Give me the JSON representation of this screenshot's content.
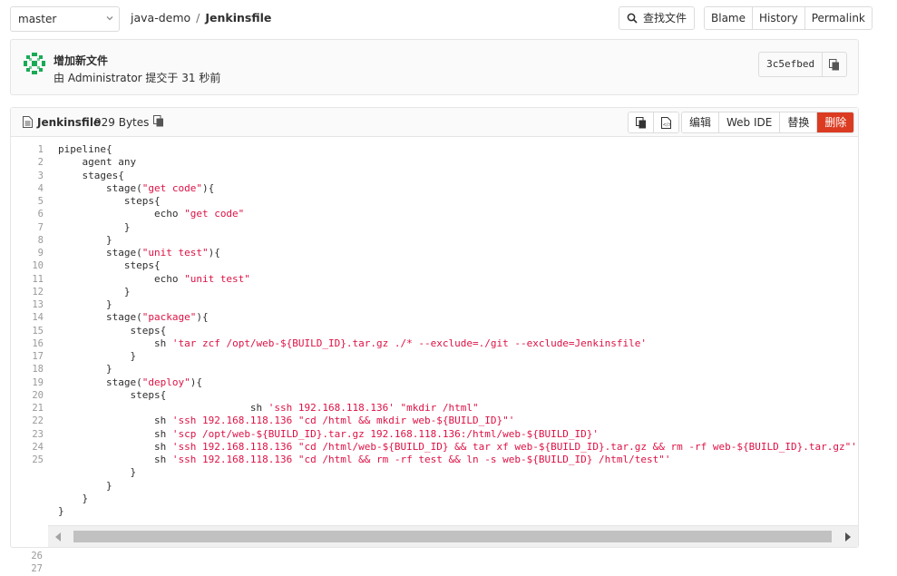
{
  "header": {
    "branch": "master",
    "breadcrumb": {
      "project": "java-demo",
      "separator": "/",
      "file": "Jenkinsfile"
    },
    "find_file_label": "查找文件",
    "view_buttons": [
      "Blame",
      "History",
      "Permalink"
    ]
  },
  "commit": {
    "title": "增加新文件",
    "meta": "由 Administrator 提交于 31 秒前",
    "sha": "3c5efbed",
    "avatar_color": "#1aaa55"
  },
  "file": {
    "name": "Jenkinsfile",
    "size": "929 Bytes",
    "actions": {
      "edit": "编辑",
      "web_ide": "Web IDE",
      "replace": "替换",
      "delete": "删除"
    },
    "delete_color": "#db3b21"
  },
  "code": {
    "line_numbers": [
      "1",
      "2",
      "3",
      "4",
      "5",
      "6",
      "7",
      "8",
      "9",
      "10",
      "11",
      "12",
      "13",
      "14",
      "15",
      "16",
      "17",
      "18",
      "19",
      "20",
      "21",
      "22",
      "23",
      "24",
      "25"
    ],
    "extra_line_numbers": [
      "26",
      "27"
    ],
    "lines": [
      [
        {
          "t": "pipeline{"
        }
      ],
      [
        {
          "t": "    agent any"
        }
      ],
      [
        {
          "t": "    stages{"
        }
      ],
      [
        {
          "t": "        stage("
        },
        {
          "t": "\"get code\"",
          "s": 1
        },
        {
          "t": "){"
        }
      ],
      [
        {
          "t": "           steps{"
        }
      ],
      [
        {
          "t": "                echo "
        },
        {
          "t": "\"get code\"",
          "s": 1
        }
      ],
      [
        {
          "t": "           }"
        }
      ],
      [
        {
          "t": "        }"
        }
      ],
      [
        {
          "t": "        stage("
        },
        {
          "t": "\"unit test\"",
          "s": 1
        },
        {
          "t": "){"
        }
      ],
      [
        {
          "t": "           steps{"
        }
      ],
      [
        {
          "t": "                echo "
        },
        {
          "t": "\"unit test\"",
          "s": 1
        }
      ],
      [
        {
          "t": "           }"
        }
      ],
      [
        {
          "t": "        }"
        }
      ],
      [
        {
          "t": "        stage("
        },
        {
          "t": "\"package\"",
          "s": 1
        },
        {
          "t": "){"
        }
      ],
      [
        {
          "t": "            steps{"
        }
      ],
      [
        {
          "t": "                sh "
        },
        {
          "t": "'tar zcf /opt/web-${BUILD_ID}.tar.gz ./* --exclude=./git --exclude=Jenkinsfile'",
          "s": 1
        }
      ],
      [
        {
          "t": "            }"
        }
      ],
      [
        {
          "t": "        }"
        }
      ],
      [
        {
          "t": "        stage("
        },
        {
          "t": "\"deploy\"",
          "s": 1
        },
        {
          "t": "){"
        }
      ],
      [
        {
          "t": "            steps{"
        }
      ],
      [
        {
          "t": "                                sh "
        },
        {
          "t": "'ssh 192.168.118.136' \"mkdir /html\"",
          "s": 1
        }
      ],
      [
        {
          "t": "                sh "
        },
        {
          "t": "'ssh 192.168.118.136 \"cd /html && mkdir web-${BUILD_ID}\"'",
          "s": 1
        }
      ],
      [
        {
          "t": "                sh "
        },
        {
          "t": "'scp /opt/web-${BUILD_ID}.tar.gz 192.168.118.136:/html/web-${BUILD_ID}'",
          "s": 1
        }
      ],
      [
        {
          "t": "                sh "
        },
        {
          "t": "'ssh 192.168.118.136 \"cd /html/web-${BUILD_ID} && tar xf web-${BUILD_ID}.tar.gz && rm -rf web-${BUILD_ID}.tar.gz\"'",
          "s": 1
        }
      ],
      [
        {
          "t": "                sh "
        },
        {
          "t": "'ssh 192.168.118.136 \"cd /html && rm -rf test && ln -s web-${BUILD_ID} /html/test\"'",
          "s": 1
        }
      ],
      [
        {
          "t": "            }"
        }
      ],
      [
        {
          "t": "        }"
        }
      ],
      [
        {
          "t": "    }"
        }
      ],
      [
        {
          "t": "}"
        }
      ]
    ]
  }
}
